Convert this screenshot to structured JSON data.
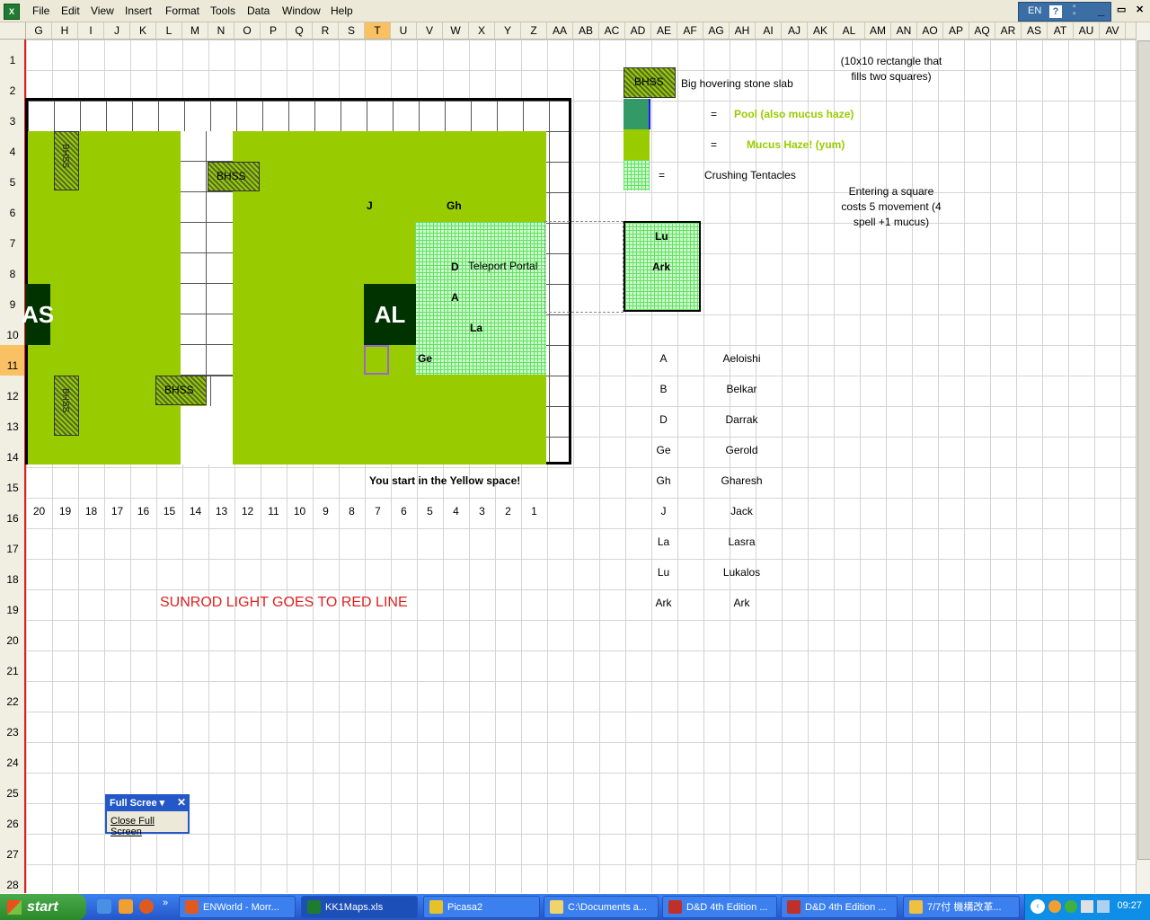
{
  "menu": [
    "File",
    "Edit",
    "View",
    "Insert",
    "Format",
    "Tools",
    "Data",
    "Window",
    "Help"
  ],
  "app_icon": "excel-icon",
  "language": "EN",
  "help_glyph": "?",
  "window_buttons": {
    "minimize": "_",
    "restore": "▭",
    "close": "✕"
  },
  "columns": [
    "G",
    "H",
    "I",
    "J",
    "K",
    "L",
    "M",
    "N",
    "O",
    "P",
    "Q",
    "R",
    "S",
    "T",
    "U",
    "V",
    "W",
    "X",
    "Y",
    "Z",
    "AA",
    "AB",
    "AC",
    "AD",
    "AE",
    "AF",
    "AG",
    "AH",
    "AI",
    "AJ",
    "AK",
    "AL",
    "AM",
    "AN",
    "AO",
    "AP",
    "AQ",
    "AR",
    "AS",
    "AT",
    "AU",
    "AV"
  ],
  "selected_column": "T",
  "rows": [
    "1",
    "2",
    "3",
    "4",
    "5",
    "6",
    "7",
    "8",
    "9",
    "10",
    "11",
    "12",
    "13",
    "14",
    "15",
    "16",
    "17",
    "18",
    "19",
    "20",
    "21",
    "22",
    "23",
    "24",
    "25",
    "26",
    "27",
    "28"
  ],
  "selected_row": "11",
  "map": {
    "bhss_label": "BHSS",
    "token_as": "AS",
    "token_al": "AL",
    "j": "J",
    "gh": "Gh",
    "d": "D",
    "a": "A",
    "la": "La",
    "ge": "Ge",
    "teleport": "Teleport Portal",
    "start_note": "You start in the Yellow space!",
    "numbers": [
      "20",
      "19",
      "18",
      "17",
      "16",
      "15",
      "14",
      "13",
      "12",
      "11",
      "10",
      "9",
      "8",
      "7",
      "6",
      "5",
      "4",
      "3",
      "2",
      "1"
    ],
    "sunrod": "SUNROD LIGHT GOES TO RED LINE"
  },
  "legend": {
    "rect_note": "(10x10 rectangle that fills two squares)",
    "bhss": "Big hovering stone slab",
    "eq": "=",
    "pool": "Pool (also mucus haze)",
    "mucus": "Mucus Haze! (yum)",
    "tentacles": "Crushing Tentacles",
    "entering": "Entering a square costs 5 movement (4 spell +1 mucus)",
    "portal_lu": "Lu",
    "portal_ark": "Ark"
  },
  "characters": [
    {
      "abbr": "A",
      "name": "Aeloishi"
    },
    {
      "abbr": "B",
      "name": "Belkar"
    },
    {
      "abbr": "D",
      "name": "Darrak"
    },
    {
      "abbr": "Ge",
      "name": "Gerold"
    },
    {
      "abbr": "Gh",
      "name": "Gharesh"
    },
    {
      "abbr": "J",
      "name": "Jack"
    },
    {
      "abbr": "La",
      "name": "Lasra"
    },
    {
      "abbr": "Lu",
      "name": "Lukalos"
    },
    {
      "abbr": "Ark",
      "name": "Ark"
    }
  ],
  "fullscreen": {
    "title": "Full Scree",
    "close_btn": "Close Full Screen"
  },
  "taskbar": {
    "start": "start",
    "tasks": [
      "ENWorld - Morr...",
      "KK1Maps.xls",
      "Picasa2",
      "C:\\Documents a...",
      "D&D 4th Edition ...",
      "D&D 4th Edition ...",
      "7/7付 機構改革..."
    ],
    "clock": "09:27"
  }
}
